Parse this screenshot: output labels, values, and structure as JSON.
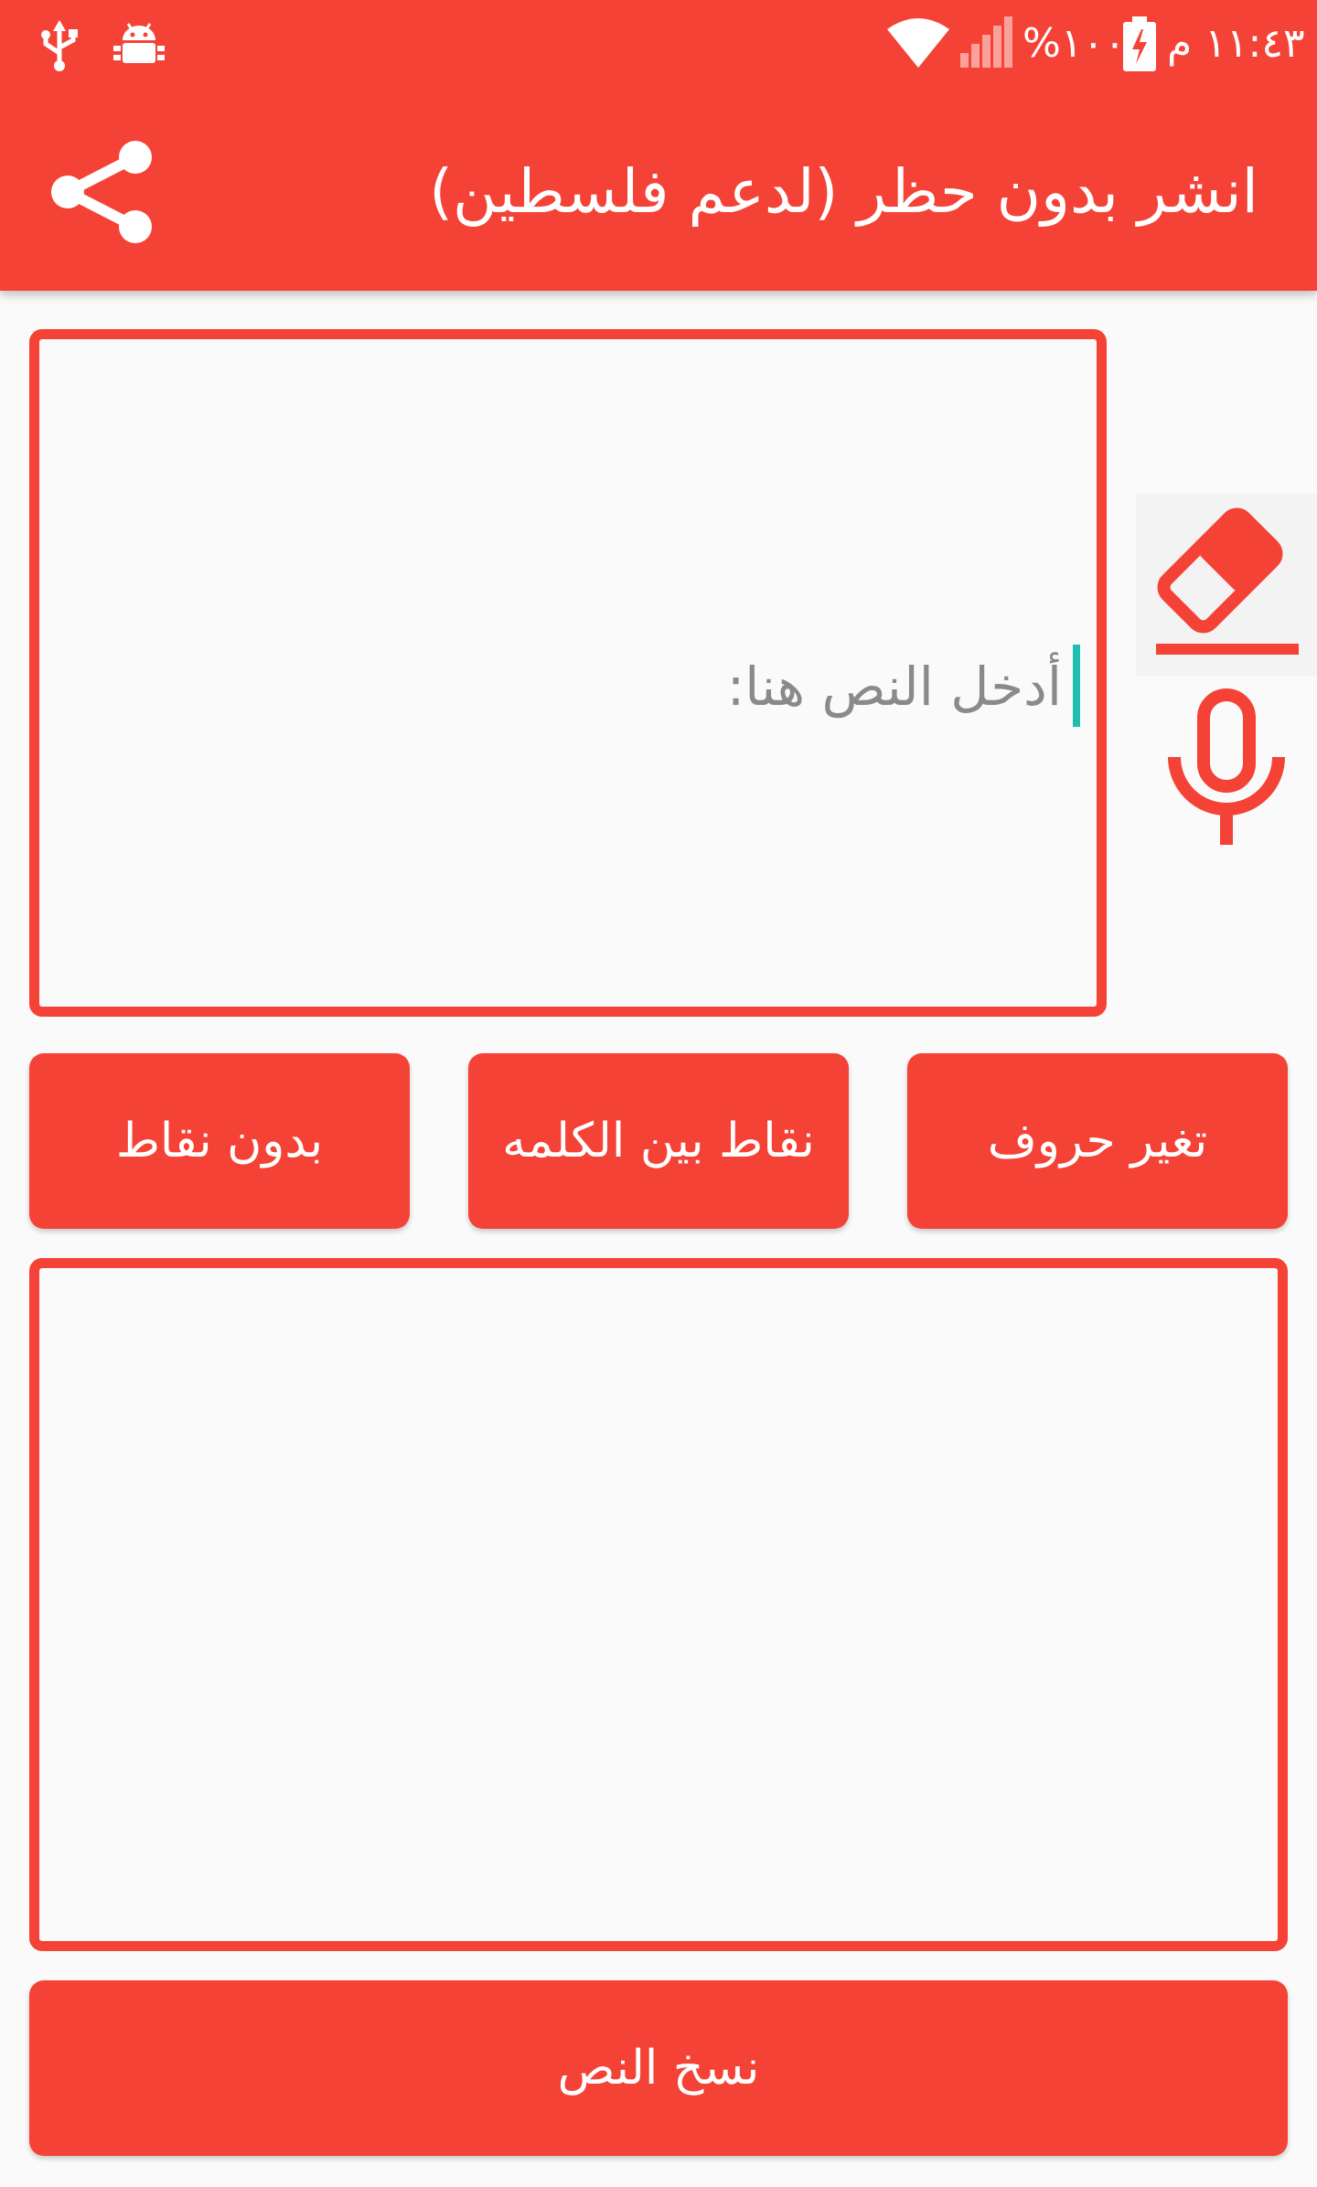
{
  "status_bar": {
    "time": "١١:٤٣ م",
    "battery_percent": "%١٠٠",
    "icons": [
      "usb-icon",
      "android-debug-icon",
      "wifi-icon",
      "cell-signal-icon",
      "battery-charging-icon"
    ]
  },
  "app_bar": {
    "title": "انشر بدون حظر (لدعم فلسطين)",
    "share_icon": "share-icon",
    "background_color": "#f44336"
  },
  "input": {
    "placeholder": "أدخل النص هنا:",
    "value": ""
  },
  "tools": {
    "eraser_icon": "eraser-icon",
    "mic_icon": "microphone-icon"
  },
  "actions": {
    "no_dots": "بدون نقاط",
    "dots_between_word": "نقاط بين الكلمه",
    "change_letters": "تغير حروف"
  },
  "output": {
    "value": ""
  },
  "copy_button": "نسخ النص"
}
